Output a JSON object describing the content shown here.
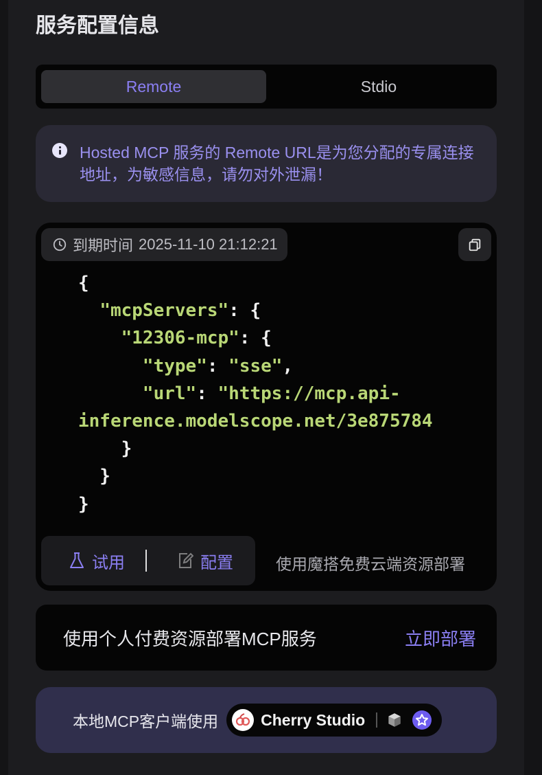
{
  "section": {
    "title": "服务配置信息"
  },
  "tabs": [
    {
      "label": "Remote",
      "active": true
    },
    {
      "label": "Stdio",
      "active": false
    }
  ],
  "notice": {
    "icon": "info-icon",
    "text": "Hosted MCP 服务的 Remote URL是为您分配的专属连接地址，为敏感信息，请勿对外泄漏！"
  },
  "config": {
    "expire_label": "到期时间",
    "expire_time": "2025-11-10 21:12:21",
    "code": {
      "root_key": "mcpServers",
      "server_name": "12306-mcp",
      "type_key": "type",
      "type_value": "sse",
      "url_key": "url",
      "url_line1": "https://mcp.api-",
      "url_line2": "inference.modelscope.net/3e875784"
    },
    "try_label": "试用",
    "config_label": "配置",
    "hint": "使用魔搭免费云端资源部署"
  },
  "deploy": {
    "text": "使用个人付费资源部署MCP服务",
    "action": "立即部署"
  },
  "client": {
    "label": "本地MCP客户端使用",
    "app_name": "Cherry Studio"
  },
  "colors": {
    "accent": "#8b7ff3",
    "string": "#b9d776",
    "notice_bg": "#2a2935"
  }
}
